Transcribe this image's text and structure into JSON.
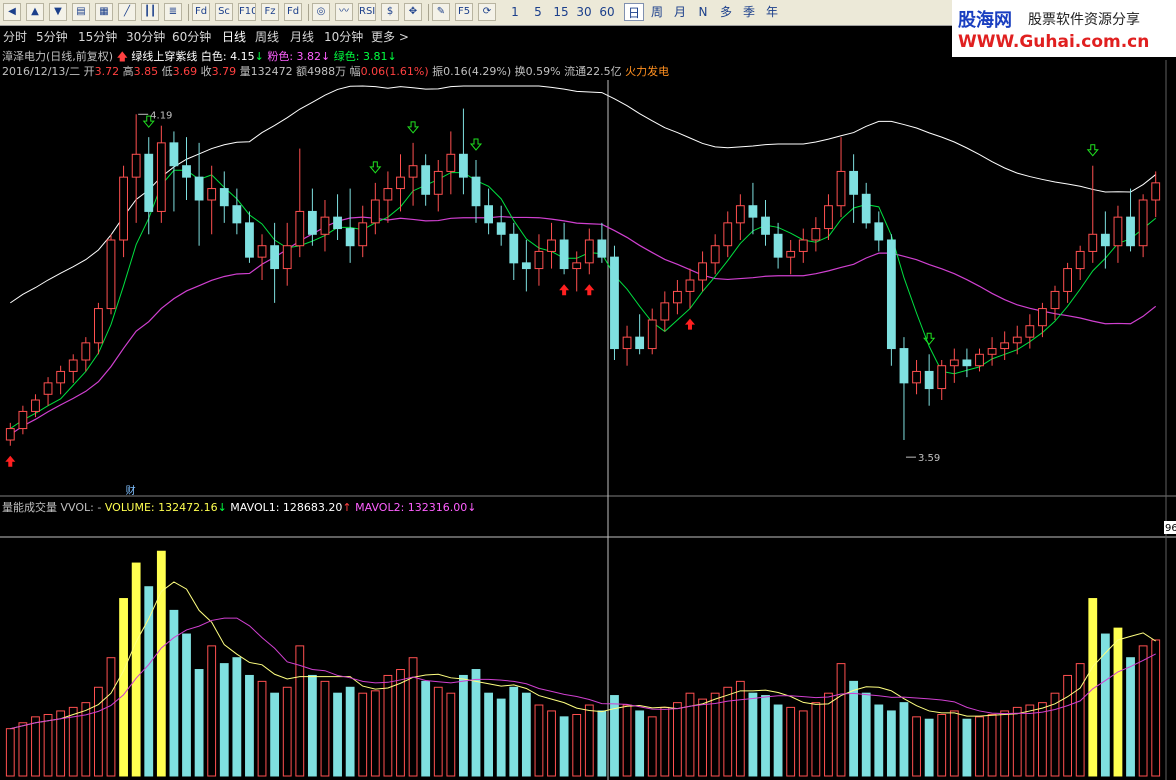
{
  "toolbar": {
    "icons": [
      "left-arrow-icon",
      "up-arrow-icon",
      "down-arrow-icon",
      "table-icon",
      "grid-icon",
      "line-chart-icon",
      "candle-icon",
      "list-icon",
      "fund-icon",
      "stock-icon",
      "f10-icon",
      "fund-flow-icon",
      "refresh-icon",
      "indicator-icon",
      "rsi-icon",
      "dollar-icon",
      "move-icon",
      "pen-icon",
      "f5-icon",
      "cycle-icon"
    ],
    "icon_labels": [
      "◀",
      "▲",
      "▼",
      "▤",
      "▦",
      "╱",
      "┃┃",
      "≣",
      "Fd",
      "Sc",
      "F10",
      "Fz",
      "Fd",
      "◎",
      "〰",
      "RSI",
      "$",
      "✥",
      "✎",
      "F5",
      "⟳"
    ],
    "minutes": [
      "1",
      "5",
      "15",
      "30",
      "60"
    ],
    "periods": [
      "日",
      "周",
      "月",
      "N",
      "多",
      "季",
      "年"
    ]
  },
  "logo": {
    "name": "股海网",
    "tagline": "股票软件资源分享",
    "url": "WWW.Guhai.com.cn"
  },
  "period_bar": {
    "items": [
      "分时",
      "5分钟",
      "15分钟",
      "30分钟",
      "60分钟",
      "日线",
      "周线",
      "月线",
      "10分钟",
      "更多 >"
    ],
    "active_index": 5
  },
  "header": {
    "stock": "漳泽电力(日线,前复权)",
    "indicator_name": "绿线上穿紫线",
    "white_label": "白色: 4.15",
    "pink_label": "粉色: 3.82",
    "green_label": "绿色: 3.81"
  },
  "quote": {
    "date": "2016/12/13/二",
    "open_label": "开",
    "open": "3.72",
    "high_label": "高",
    "high": "3.85",
    "low_label": "低",
    "low": "3.69",
    "close_label": "收",
    "close": "3.79",
    "volume_label": "量",
    "volume": "132472",
    "amount_label": "额",
    "amount": "4988万",
    "change_label": "幅",
    "change": "0.06(1.61%)",
    "amplitude_label": "振",
    "amplitude": "0.16(4.29%)",
    "turnover_label": "换",
    "turnover": "0.59%",
    "float_label": "流通",
    "float": "22.5亿",
    "sector": "火力发电"
  },
  "volume_panel": {
    "title": "量能成交量",
    "vvol": "VVOL: -",
    "volume": "VOLUME: 132472.16",
    "mavol1": "MAVOL1: 128683.20",
    "mavol2": "MAVOL2: 132316.00",
    "right_tag": "96"
  },
  "chart_annotations": {
    "high_mark": "4.19",
    "low_mark": "3.59",
    "cai_mark": "财"
  },
  "colors": {
    "up": "#ff5050",
    "down": "#7fe0e0",
    "ma_green": "#00e040",
    "ma_purple": "#d040d0",
    "white_line": "#ffffff",
    "vol_yellow": "#ffff50"
  },
  "chart_data": {
    "type": "candlestick",
    "y_range": [
      3.55,
      4.25
    ],
    "ohlc": [
      [
        3.62,
        3.65,
        3.61,
        3.64
      ],
      [
        3.64,
        3.68,
        3.63,
        3.67
      ],
      [
        3.67,
        3.7,
        3.66,
        3.69
      ],
      [
        3.7,
        3.73,
        3.68,
        3.72
      ],
      [
        3.72,
        3.75,
        3.7,
        3.74
      ],
      [
        3.74,
        3.77,
        3.72,
        3.76
      ],
      [
        3.76,
        3.8,
        3.74,
        3.79
      ],
      [
        3.79,
        3.86,
        3.77,
        3.85
      ],
      [
        3.85,
        3.98,
        3.84,
        3.97
      ],
      [
        3.97,
        4.1,
        3.94,
        4.08
      ],
      [
        4.08,
        4.19,
        4.0,
        4.12
      ],
      [
        4.12,
        4.15,
        3.98,
        4.02
      ],
      [
        4.02,
        4.17,
        4.0,
        4.14
      ],
      [
        4.14,
        4.16,
        4.02,
        4.1
      ],
      [
        4.1,
        4.15,
        4.04,
        4.08
      ],
      [
        4.08,
        4.14,
        3.96,
        4.04
      ],
      [
        4.04,
        4.1,
        3.98,
        4.06
      ],
      [
        4.06,
        4.09,
        4.0,
        4.03
      ],
      [
        4.03,
        4.06,
        3.98,
        4.0
      ],
      [
        4.0,
        4.02,
        3.93,
        3.94
      ],
      [
        3.94,
        3.98,
        3.9,
        3.96
      ],
      [
        3.96,
        4.0,
        3.86,
        3.92
      ],
      [
        3.92,
        4.0,
        3.89,
        3.96
      ],
      [
        3.96,
        4.13,
        3.94,
        4.02
      ],
      [
        4.02,
        4.06,
        3.96,
        3.98
      ],
      [
        3.98,
        4.04,
        3.95,
        4.01
      ],
      [
        4.01,
        4.05,
        3.97,
        3.99
      ],
      [
        3.99,
        4.06,
        3.93,
        3.96
      ],
      [
        3.96,
        4.03,
        3.94,
        4.0
      ],
      [
        4.0,
        4.07,
        3.98,
        4.04
      ],
      [
        4.04,
        4.09,
        4.0,
        4.06
      ],
      [
        4.06,
        4.12,
        4.02,
        4.08
      ],
      [
        4.08,
        4.14,
        4.03,
        4.1
      ],
      [
        4.1,
        4.12,
        4.03,
        4.05
      ],
      [
        4.05,
        4.11,
        4.02,
        4.09
      ],
      [
        4.09,
        4.16,
        4.05,
        4.12
      ],
      [
        4.12,
        4.2,
        4.05,
        4.08
      ],
      [
        4.08,
        4.11,
        4.0,
        4.03
      ],
      [
        4.03,
        4.06,
        3.98,
        4.0
      ],
      [
        4.0,
        4.03,
        3.96,
        3.98
      ],
      [
        3.98,
        4.0,
        3.9,
        3.93
      ],
      [
        3.93,
        3.97,
        3.88,
        3.92
      ],
      [
        3.92,
        3.98,
        3.89,
        3.95
      ],
      [
        3.95,
        4.0,
        3.92,
        3.97
      ],
      [
        3.97,
        4.0,
        3.91,
        3.92
      ],
      [
        3.92,
        3.95,
        3.88,
        3.93
      ],
      [
        3.93,
        3.99,
        3.91,
        3.97
      ],
      [
        3.97,
        4.0,
        3.93,
        3.94
      ],
      [
        3.94,
        3.96,
        3.76,
        3.78
      ],
      [
        3.78,
        3.82,
        3.75,
        3.8
      ],
      [
        3.8,
        3.84,
        3.77,
        3.78
      ],
      [
        3.78,
        3.85,
        3.77,
        3.83
      ],
      [
        3.83,
        3.88,
        3.81,
        3.86
      ],
      [
        3.86,
        3.9,
        3.84,
        3.88
      ],
      [
        3.88,
        3.92,
        3.85,
        3.9
      ],
      [
        3.9,
        3.95,
        3.88,
        3.93
      ],
      [
        3.93,
        3.98,
        3.91,
        3.96
      ],
      [
        3.96,
        4.02,
        3.94,
        4.0
      ],
      [
        4.0,
        4.05,
        3.97,
        4.03
      ],
      [
        4.03,
        4.07,
        3.98,
        4.01
      ],
      [
        4.01,
        4.04,
        3.96,
        3.98
      ],
      [
        3.98,
        4.0,
        3.92,
        3.94
      ],
      [
        3.94,
        3.97,
        3.91,
        3.95
      ],
      [
        3.95,
        3.99,
        3.93,
        3.97
      ],
      [
        3.97,
        4.01,
        3.95,
        3.99
      ],
      [
        3.99,
        4.05,
        3.97,
        4.03
      ],
      [
        4.03,
        4.15,
        4.01,
        4.09
      ],
      [
        4.09,
        4.12,
        4.0,
        4.05
      ],
      [
        4.05,
        4.07,
        3.99,
        4.0
      ],
      [
        4.0,
        4.02,
        3.95,
        3.97
      ],
      [
        3.97,
        3.98,
        3.75,
        3.78
      ],
      [
        3.78,
        3.8,
        3.62,
        3.72
      ],
      [
        3.72,
        3.76,
        3.7,
        3.74
      ],
      [
        3.74,
        3.77,
        3.68,
        3.71
      ],
      [
        3.71,
        3.76,
        3.69,
        3.75
      ],
      [
        3.75,
        3.78,
        3.72,
        3.76
      ],
      [
        3.76,
        3.78,
        3.73,
        3.75
      ],
      [
        3.75,
        3.78,
        3.74,
        3.77
      ],
      [
        3.77,
        3.8,
        3.75,
        3.78
      ],
      [
        3.78,
        3.81,
        3.76,
        3.79
      ],
      [
        3.79,
        3.82,
        3.77,
        3.8
      ],
      [
        3.8,
        3.84,
        3.78,
        3.82
      ],
      [
        3.82,
        3.86,
        3.8,
        3.85
      ],
      [
        3.85,
        3.89,
        3.83,
        3.88
      ],
      [
        3.88,
        3.93,
        3.86,
        3.92
      ],
      [
        3.92,
        3.96,
        3.9,
        3.95
      ],
      [
        3.95,
        4.1,
        3.93,
        3.98
      ],
      [
        3.98,
        4.02,
        3.92,
        3.96
      ],
      [
        3.96,
        4.03,
        3.93,
        4.01
      ],
      [
        4.01,
        4.06,
        3.95,
        3.96
      ],
      [
        3.96,
        4.05,
        3.94,
        4.04
      ],
      [
        4.04,
        4.09,
        4.01,
        4.07
      ]
    ],
    "volumes": [
      40,
      45,
      50,
      52,
      55,
      58,
      62,
      75,
      100,
      150,
      180,
      160,
      190,
      140,
      120,
      90,
      110,
      95,
      100,
      85,
      80,
      70,
      75,
      110,
      85,
      80,
      70,
      75,
      70,
      72,
      85,
      90,
      100,
      80,
      75,
      70,
      85,
      90,
      70,
      65,
      75,
      70,
      60,
      55,
      50,
      52,
      60,
      55,
      68,
      60,
      55,
      50,
      58,
      62,
      70,
      65,
      70,
      75,
      80,
      70,
      68,
      60,
      58,
      55,
      62,
      70,
      95,
      80,
      70,
      60,
      55,
      62,
      50,
      48,
      52,
      55,
      48,
      50,
      52,
      55,
      58,
      60,
      62,
      70,
      85,
      95,
      150,
      120,
      125,
      100,
      110,
      115
    ]
  }
}
